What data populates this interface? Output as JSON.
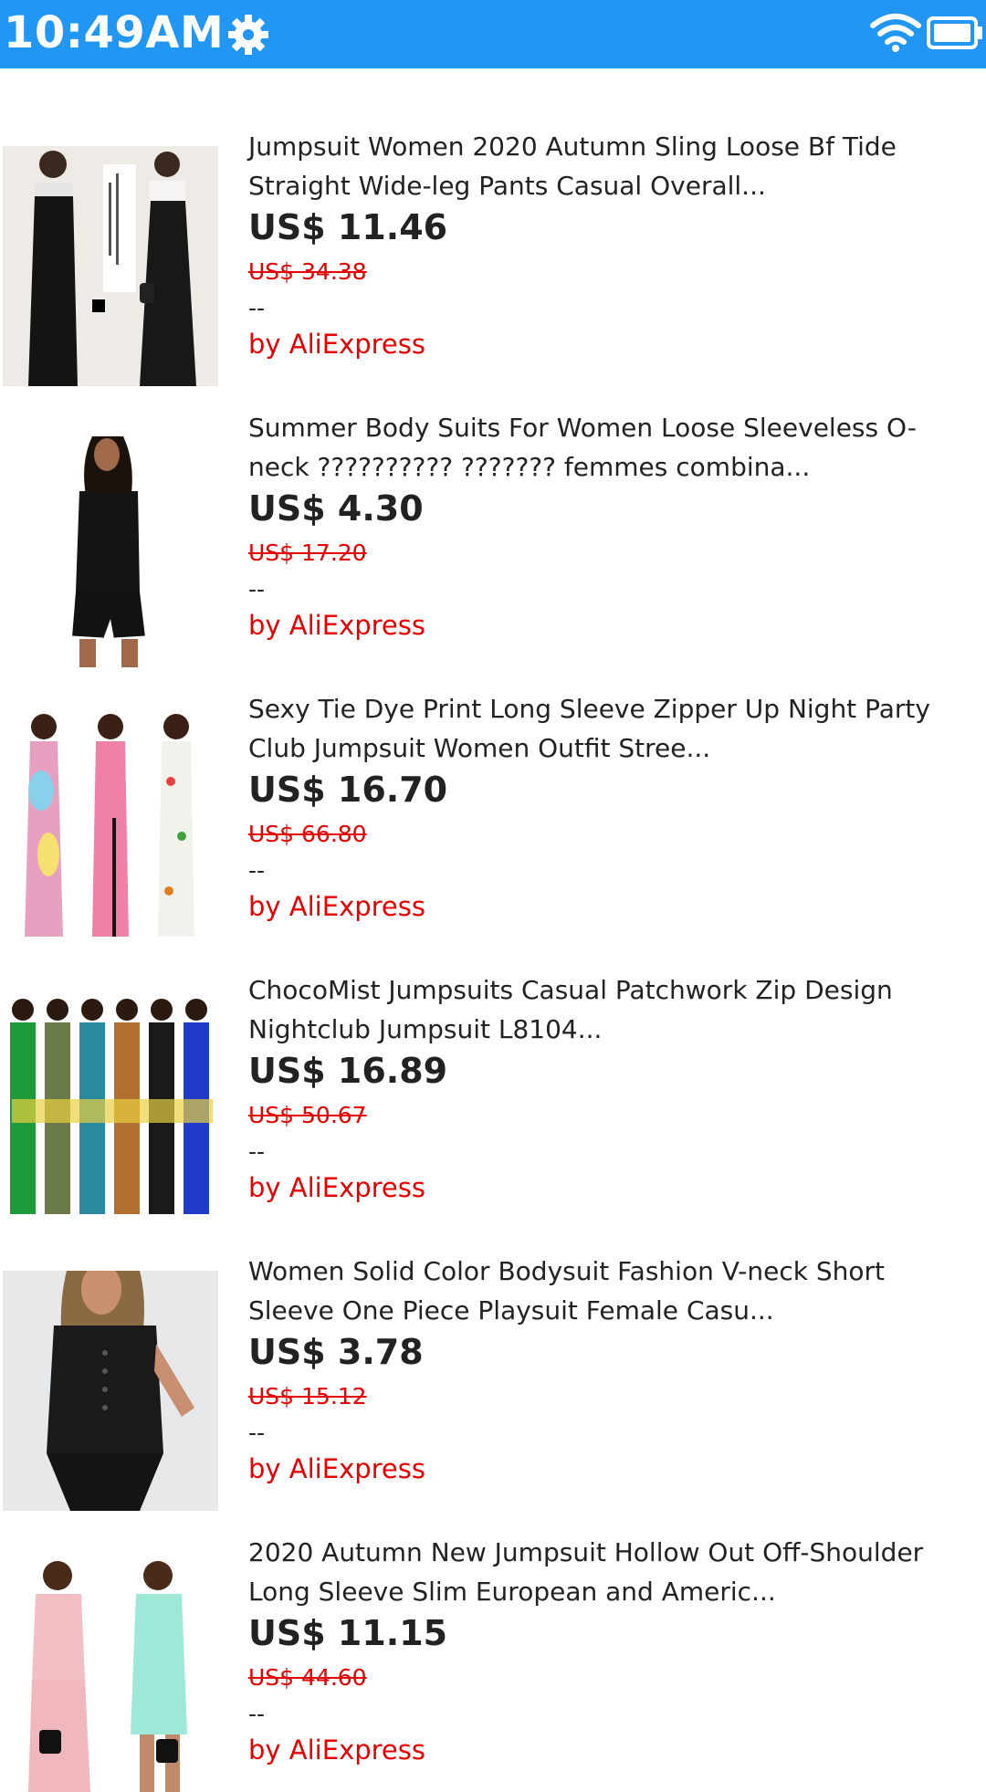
{
  "status_bar": {
    "time": "10:49AM",
    "icons": [
      "gear-icon",
      "wifi-icon",
      "battery-icon"
    ],
    "color": "#2196F3"
  },
  "products": [
    {
      "title": "Jumpsuit Women 2020 Autumn Sling Loose Bf Tide Straight Wide-leg Pants Casual Overall...",
      "price": "US$ 11.46",
      "old_price": "US$ 34.38",
      "rating": "--",
      "seller": "by AliExpress",
      "image_icon": "product-image"
    },
    {
      "title": "Summer Body Suits For Women Loose Sleeveless O-neck ?????????? ??????? femmes combina...",
      "price": "US$ 4.30",
      "old_price": "US$ 17.20",
      "rating": "--",
      "seller": "by AliExpress",
      "image_icon": "product-image"
    },
    {
      "title": "Sexy Tie Dye Print Long Sleeve Zipper Up Night Party Club Jumpsuit Women Outfit Stree...",
      "price": "US$ 16.70",
      "old_price": "US$ 66.80",
      "rating": "--",
      "seller": "by AliExpress",
      "image_icon": "product-image"
    },
    {
      "title": "ChocoMist Jumpsuits Casual Patchwork Zip Design Nightclub Jumpsuit L8104...",
      "price": "US$ 16.89",
      "old_price": "US$ 50.67",
      "rating": "--",
      "seller": "by AliExpress",
      "image_icon": "product-image"
    },
    {
      "title": "Women Solid Color Bodysuit Fashion V-neck Short Sleeve One Piece Playsuit Female Casu...",
      "price": "US$ 3.78",
      "old_price": "US$ 15.12",
      "rating": "--",
      "seller": "by AliExpress",
      "image_icon": "product-image"
    },
    {
      "title": "2020 Autumn New Jumpsuit Hollow Out Off-Shoulder Long Sleeve Slim European and Americ...",
      "price": "US$ 11.15",
      "old_price": "US$ 44.60",
      "rating": "--",
      "seller": "by AliExpress",
      "image_icon": "product-image"
    }
  ]
}
